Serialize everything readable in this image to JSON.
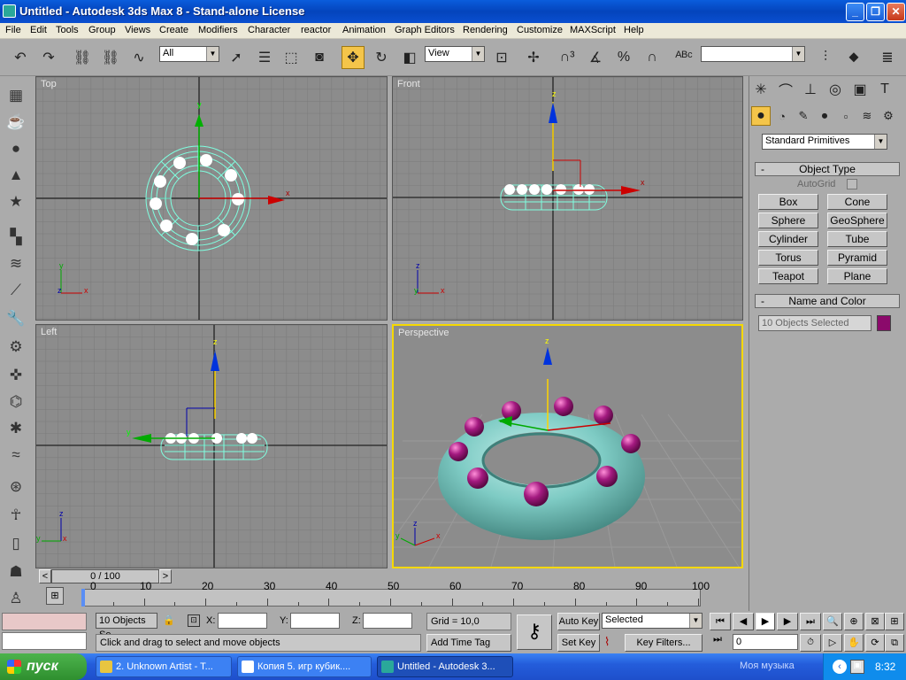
{
  "window": {
    "title": "Untitled - Autodesk 3ds Max 8   - Stand-alone License"
  },
  "menu": [
    "File",
    "Edit",
    "Tools",
    "Group",
    "Views",
    "Create",
    "Modifiers",
    "Character",
    "reactor",
    "Animation",
    "Graph Editors",
    "Rendering",
    "Customize",
    "MAXScript",
    "Help"
  ],
  "toolbar": {
    "selection_filter": "All",
    "ref_coord": "View",
    "named_selection": ""
  },
  "viewports": {
    "top": "Top",
    "front": "Front",
    "left": "Left",
    "perspective": "Perspective"
  },
  "axes": {
    "x": "x",
    "y": "y",
    "z": "z"
  },
  "command_panel": {
    "category": "Standard Primitives",
    "object_type_title": "Object Type",
    "autogrid": "AutoGrid",
    "buttons": [
      "Box",
      "Cone",
      "Sphere",
      "GeoSphere",
      "Cylinder",
      "Tube",
      "Torus",
      "Pyramid",
      "Teapot",
      "Plane"
    ],
    "name_color_title": "Name and Color",
    "name_field": "10 Objects Selected",
    "object_color": "#8B0A6B"
  },
  "timeline": {
    "frame_counter": "0 / 100",
    "ticks": [
      "0",
      "10",
      "20",
      "30",
      "40",
      "50",
      "60",
      "70",
      "80",
      "90",
      "100"
    ]
  },
  "status": {
    "selection": "10 Objects Se",
    "x_label": "X:",
    "y_label": "Y:",
    "z_label": "Z:",
    "x_value": "",
    "y_value": "",
    "z_value": "",
    "grid": "Grid = 10,0",
    "add_time_tag": "Add Time Tag",
    "prompt": "Click and drag to select and move objects",
    "auto_key": "Auto Key",
    "set_key": "Set Key",
    "key_mode": "Selected",
    "key_filters": "Key Filters...",
    "current_frame": "0"
  },
  "taskbar": {
    "start": "пуск",
    "tasks": [
      "2. Unknown Artist - T...",
      "Копия 5. игр кубик....",
      "Untitled - Autodesk 3..."
    ],
    "tray_text": "Моя музыка",
    "clock": "8:32"
  },
  "colors": {
    "accent_active": "#F4C54A",
    "wire": "#7FFFE0",
    "viewport_bg": "#8C8C8C",
    "active_border": "#F5D800"
  }
}
